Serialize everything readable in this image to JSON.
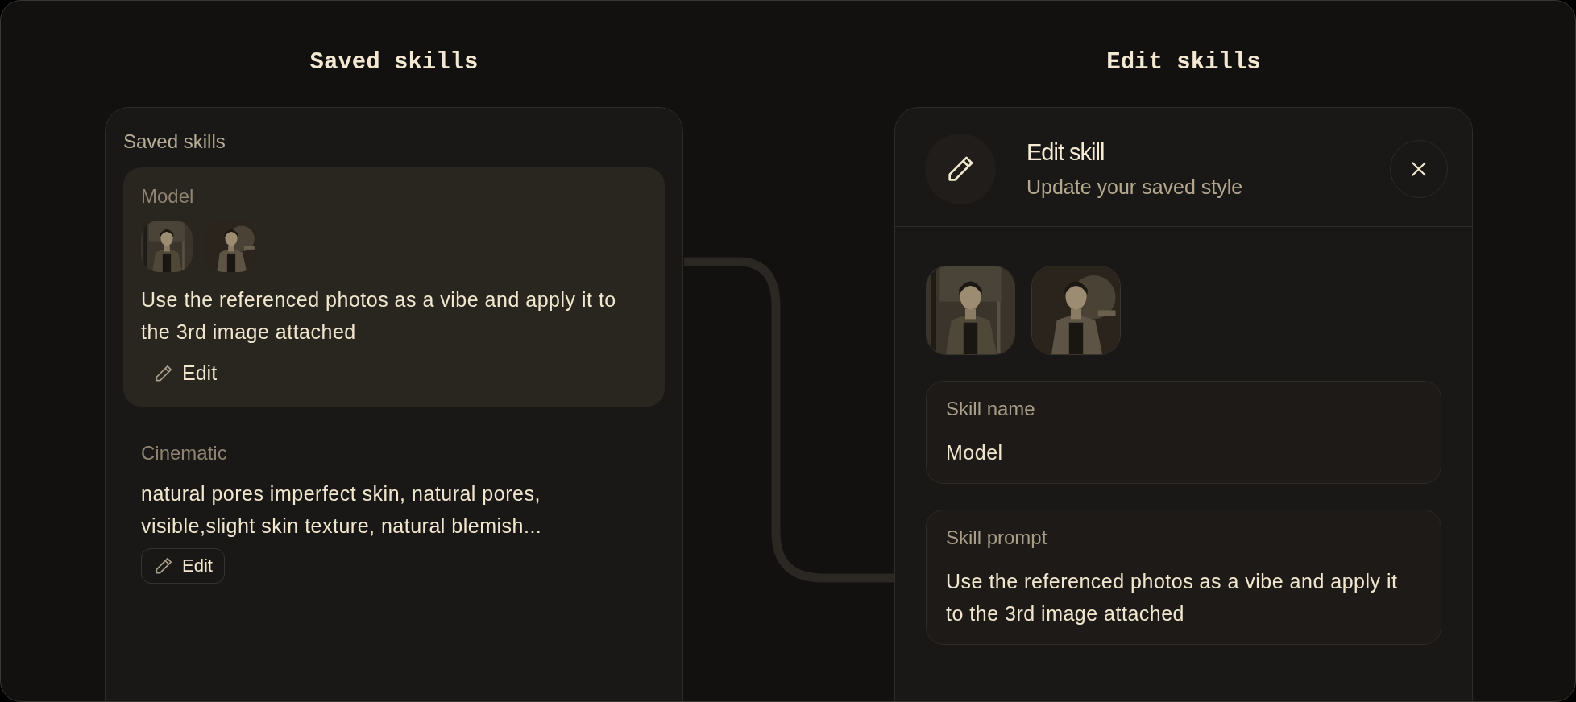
{
  "columns": [
    {
      "heading": "Saved skills"
    },
    {
      "heading": "Edit skills"
    }
  ],
  "saved_panel": {
    "title": "Saved skills",
    "skills": [
      {
        "name": "Model",
        "selected": true,
        "prompt": "Use the referenced photos as a vibe and apply it to the 3rd image attached",
        "edit_label": "Edit"
      },
      {
        "name": "Cinematic",
        "selected": false,
        "prompt": "natural pores imperfect skin, natural pores, visible,slight skin texture, natural blemish...",
        "edit_label": "Edit"
      }
    ]
  },
  "edit_panel": {
    "title": "Edit skill",
    "subtitle": "Update your saved style",
    "fields": [
      {
        "label": "Skill name",
        "value": "Model"
      },
      {
        "label": "Skill prompt",
        "value": "Use the referenced photos as a vibe and apply it to the 3rd image attached"
      }
    ]
  }
}
